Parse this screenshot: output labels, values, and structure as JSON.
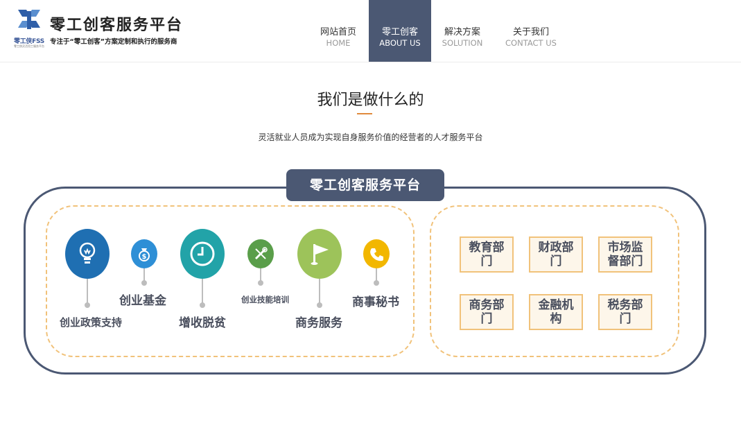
{
  "header": {
    "logo": {
      "mark_text": "零工侠FSS",
      "mark_subtext": "零工侠灵活用工服务平台",
      "title": "零工创客服务平台",
      "slogan": "专注于“零工创客”方案定制和执行的服务商"
    },
    "nav": [
      {
        "zh": "网站首页",
        "en": "HOME",
        "active": false
      },
      {
        "zh": "零工创客",
        "en": "ABOUT US",
        "active": true
      },
      {
        "zh": "解决方案",
        "en": "SOLUTION",
        "active": false
      },
      {
        "zh": "关于我们",
        "en": "CONTACT US",
        "active": false
      }
    ]
  },
  "intro": {
    "title": "我们是做什么的",
    "subtitle": "灵活就业人员成为实现自身服务价值的经营者的人才服务平台"
  },
  "diagram": {
    "banner": "零工创客服务平台",
    "services": [
      {
        "label": "创业政策支持",
        "icon": "lightbulb-icon",
        "color": "#1f6fb2"
      },
      {
        "label": "创业基金",
        "icon": "money-bag-icon",
        "color": "#2e8fd6"
      },
      {
        "label": "增收脱贫",
        "icon": "clock-icon",
        "color": "#22a3a8"
      },
      {
        "label": "创业技能培训",
        "icon": "tools-icon",
        "color": "#5a9e4a"
      },
      {
        "label": "商务服务",
        "icon": "flag-icon",
        "color": "#9dc35a"
      },
      {
        "label": "商事秘书",
        "icon": "phone-icon",
        "color": "#f2b700"
      }
    ],
    "departments": [
      "教育部门",
      "财政部门",
      "市场监督部门",
      "商务部门",
      "金融机构",
      "税务部门"
    ]
  }
}
